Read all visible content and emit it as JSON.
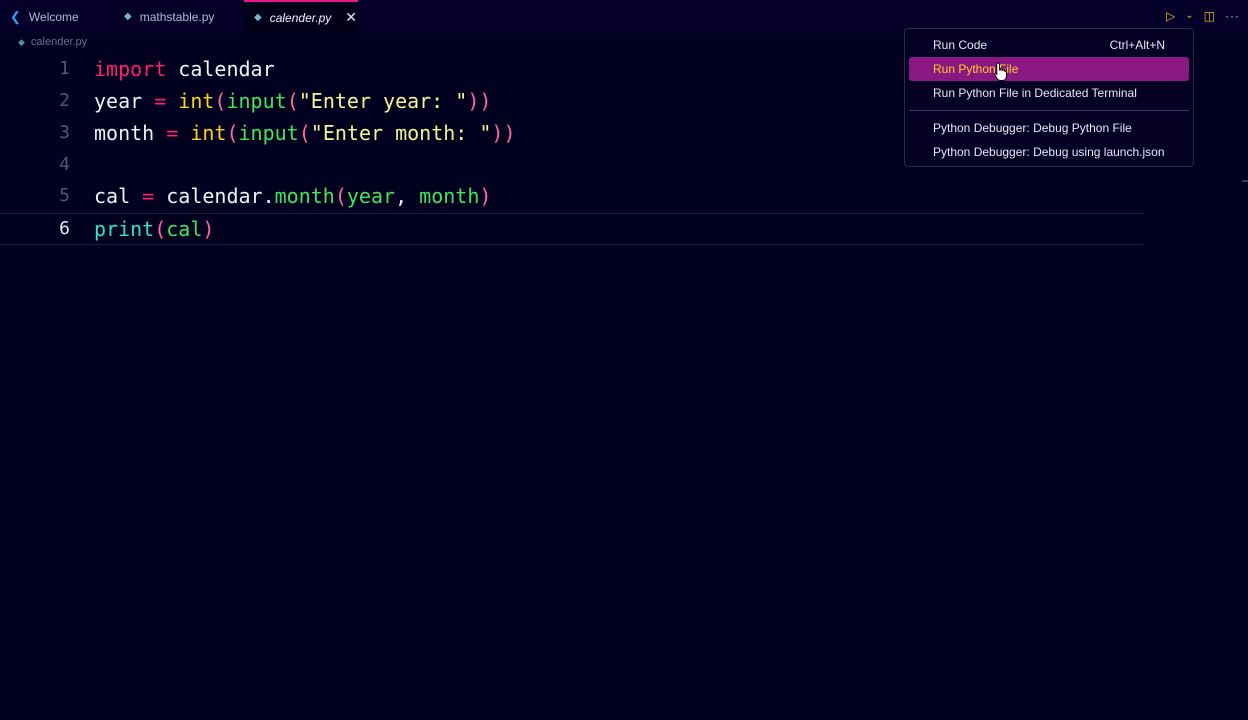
{
  "tabs": [
    {
      "label": "Welcome",
      "icon": "vscode-icon"
    },
    {
      "label": "mathstable.py",
      "icon": "python-file-icon"
    },
    {
      "label": "calender.py",
      "icon": "python-file-icon",
      "active": true
    }
  ],
  "breadcrumb": {
    "file": "calender.py"
  },
  "editor": {
    "line_numbers": [
      "1",
      "2",
      "3",
      "4",
      "5",
      "6"
    ],
    "lines": [
      {
        "tokens": [
          "import",
          " calendar"
        ]
      },
      {
        "tokens": [
          "year",
          " = ",
          "int",
          "(",
          "input",
          "(",
          "\"Enter year: \"",
          ")",
          ")"
        ]
      },
      {
        "tokens": [
          "month",
          " = ",
          "int",
          "(",
          "input",
          "(",
          "\"Enter month: \"",
          ")",
          ")"
        ]
      },
      {
        "tokens": []
      },
      {
        "tokens": [
          "cal",
          " = ",
          "calendar",
          ".",
          "month",
          "(",
          "year",
          ", ",
          "month",
          ")"
        ]
      },
      {
        "tokens": [
          "print",
          "(",
          "cal",
          ")"
        ]
      }
    ]
  },
  "run_menu": {
    "items": [
      {
        "label": "Run Code",
        "shortcut": "Ctrl+Alt+N"
      },
      {
        "label": "Run Python File",
        "highlighted": true
      },
      {
        "label": "Run Python File in Dedicated Terminal"
      },
      {
        "label": "Python Debugger: Debug Python File"
      },
      {
        "label": "Python Debugger: Debug using launch.json"
      }
    ]
  },
  "colors": {
    "background": "#02001f",
    "keyword": "#ff1f6d",
    "builtin": "#ffd21f",
    "string": "#f5f58e",
    "menu_highlight": "#8b1782",
    "tab_accent": "#e8168e"
  }
}
